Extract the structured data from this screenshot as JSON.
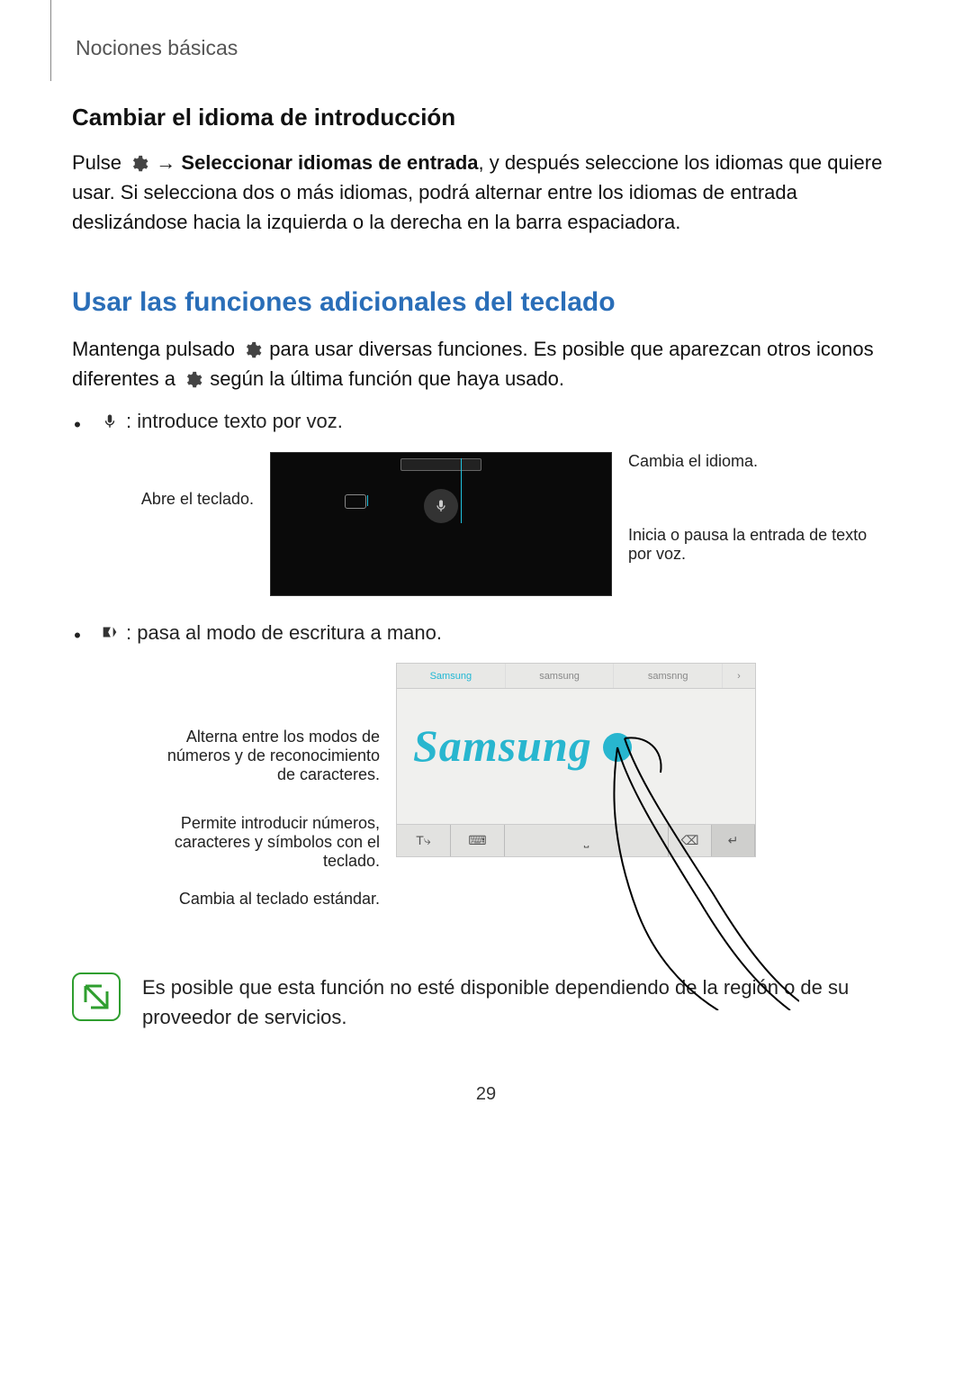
{
  "breadcrumb": "Nociones básicas",
  "section1": {
    "heading": "Cambiar el idioma de introducción",
    "p_pre": "Pulse ",
    "p_arrow": " → ",
    "p_bold": "Seleccionar idiomas de entrada",
    "p_post": ", y después seleccione los idiomas que quiere usar. Si selecciona dos o más idiomas, podrá alternar entre los idiomas de entrada deslizándose hacia la izquierda o la derecha en la barra espaciadora."
  },
  "section2": {
    "heading": "Usar las funciones adicionales del teclado",
    "p2_pre": "Mantenga pulsado ",
    "p2_mid": " para usar diversas funciones. Es posible que aparezcan otros iconos diferentes a ",
    "p2_post": " según la última función que haya usado."
  },
  "bullet1": {
    "text": " : introduce texto por voz."
  },
  "fig1": {
    "left": {
      "open_kbd": "Abre el teclado."
    },
    "right": {
      "change_lang": "Cambia el idioma.",
      "voice_toggle": "Inicia o pausa la entrada de texto por voz."
    }
  },
  "bullet2": {
    "text": " : pasa al modo de escritura a mano."
  },
  "fig2": {
    "sug1": "Samsung",
    "sug2": "samsung",
    "sug3": "samsnng",
    "sug_arrow": "›",
    "handwriting": "Samsung",
    "key_T": "T⤷",
    "key_std": "⌨",
    "key_back": "⌫",
    "key_ret": "↵",
    "left": {
      "c1": "Alterna entre los modos de números y de reconocimiento de caracteres.",
      "c2": "Permite introducir números, caracteres y símbolos con el teclado.",
      "c3": "Cambia al teclado estándar."
    }
  },
  "note": {
    "text": "Es posible que esta función no esté disponible dependiendo de la región o de su proveedor de servicios."
  },
  "page_number": "29"
}
